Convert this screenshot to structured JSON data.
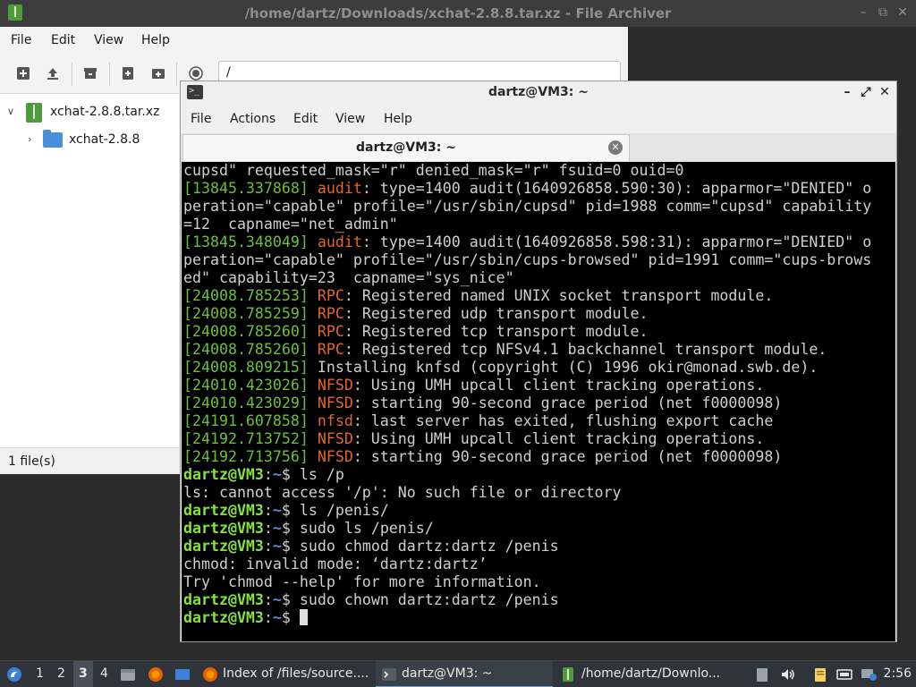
{
  "file_archiver": {
    "title": "/home/dartz/Downloads/xchat-2.8.8.tar.xz - File Archiver",
    "menu": [
      "File",
      "Edit",
      "View",
      "Help"
    ],
    "location": "/",
    "tree": [
      {
        "label": "xchat-2.8.8.tar.xz",
        "icon": "archive-icon",
        "expanded": true
      },
      {
        "label": "xchat-2.8.8",
        "icon": "folder-icon",
        "expanded": false
      }
    ],
    "status": "1 file(s)",
    "window_controls": [
      "–",
      "⧉",
      "✕"
    ]
  },
  "terminal": {
    "title": "dartz@VM3: ~",
    "menu": [
      "File",
      "Actions",
      "Edit",
      "View",
      "Help"
    ],
    "tab_label": "dartz@VM3: ~",
    "window_controls": [
      "–",
      "⤢",
      "✕"
    ],
    "lines": [
      [
        {
          "t": "cupsd\" requested_mask=\"r\" denied_mask=\"r\" fsuid=0 ouid=0",
          "c": ""
        }
      ],
      [
        {
          "t": "[13845.337868] ",
          "c": "c-green"
        },
        {
          "t": "audit",
          "c": "c-orange"
        },
        {
          "t": ": type=1400 audit(1640926858.590:30): apparmor=\"DENIED\" o",
          "c": ""
        }
      ],
      [
        {
          "t": "peration=\"capable\" profile=\"/usr/sbin/cupsd\" pid=1988 comm=\"cupsd\" capability",
          "c": ""
        }
      ],
      [
        {
          "t": "=12  capname=\"net_admin\"",
          "c": ""
        }
      ],
      [
        {
          "t": "[13845.348049] ",
          "c": "c-green"
        },
        {
          "t": "audit",
          "c": "c-orange"
        },
        {
          "t": ": type=1400 audit(1640926858.598:31): apparmor=\"DENIED\" o",
          "c": ""
        }
      ],
      [
        {
          "t": "peration=\"capable\" profile=\"/usr/sbin/cups-browsed\" pid=1991 comm=\"cups-brows",
          "c": ""
        }
      ],
      [
        {
          "t": "ed\" capability=23  capname=\"sys_nice\"",
          "c": ""
        }
      ],
      [
        {
          "t": "[24008.785253] ",
          "c": "c-green"
        },
        {
          "t": "RPC",
          "c": "c-orange"
        },
        {
          "t": ": Registered named UNIX socket transport module.",
          "c": ""
        }
      ],
      [
        {
          "t": "[24008.785259] ",
          "c": "c-green"
        },
        {
          "t": "RPC",
          "c": "c-orange"
        },
        {
          "t": ": Registered udp transport module.",
          "c": ""
        }
      ],
      [
        {
          "t": "[24008.785260] ",
          "c": "c-green"
        },
        {
          "t": "RPC",
          "c": "c-orange"
        },
        {
          "t": ": Registered tcp transport module.",
          "c": ""
        }
      ],
      [
        {
          "t": "[24008.785260] ",
          "c": "c-green"
        },
        {
          "t": "RPC",
          "c": "c-orange"
        },
        {
          "t": ": Registered tcp NFSv4.1 backchannel transport module.",
          "c": ""
        }
      ],
      [
        {
          "t": "[24008.809215] ",
          "c": "c-green"
        },
        {
          "t": "Installing knfsd (copyright (C) 1996 okir@monad.swb.de).",
          "c": ""
        }
      ],
      [
        {
          "t": "[24010.423026] ",
          "c": "c-green"
        },
        {
          "t": "NFSD",
          "c": "c-orange"
        },
        {
          "t": ": Using UMH upcall client tracking operations.",
          "c": ""
        }
      ],
      [
        {
          "t": "[24010.423029] ",
          "c": "c-green"
        },
        {
          "t": "NFSD",
          "c": "c-orange"
        },
        {
          "t": ": starting 90-second grace period (net f0000098)",
          "c": ""
        }
      ],
      [
        {
          "t": "[24191.607858] ",
          "c": "c-green"
        },
        {
          "t": "nfsd",
          "c": "c-orange"
        },
        {
          "t": ": last server has exited, flushing export cache",
          "c": ""
        }
      ],
      [
        {
          "t": "[24192.713752] ",
          "c": "c-green"
        },
        {
          "t": "NFSD",
          "c": "c-orange"
        },
        {
          "t": ": Using UMH upcall client tracking operations.",
          "c": ""
        }
      ],
      [
        {
          "t": "[24192.713756] ",
          "c": "c-green"
        },
        {
          "t": "NFSD",
          "c": "c-orange"
        },
        {
          "t": ": starting 90-second grace period (net f0000098)",
          "c": ""
        }
      ],
      [
        {
          "t": "dartz@VM3",
          "c": "c-prompt"
        },
        {
          "t": ":",
          "c": ""
        },
        {
          "t": "~",
          "c": "c-path"
        },
        {
          "t": "$ ls /p",
          "c": ""
        }
      ],
      [
        {
          "t": "ls: cannot access '/p': No such file or directory",
          "c": ""
        }
      ],
      [
        {
          "t": "dartz@VM3",
          "c": "c-prompt"
        },
        {
          "t": ":",
          "c": ""
        },
        {
          "t": "~",
          "c": "c-path"
        },
        {
          "t": "$ ls /penis/",
          "c": ""
        }
      ],
      [
        {
          "t": "dartz@VM3",
          "c": "c-prompt"
        },
        {
          "t": ":",
          "c": ""
        },
        {
          "t": "~",
          "c": "c-path"
        },
        {
          "t": "$ sudo ls /penis/",
          "c": ""
        }
      ],
      [
        {
          "t": "dartz@VM3",
          "c": "c-prompt"
        },
        {
          "t": ":",
          "c": ""
        },
        {
          "t": "~",
          "c": "c-path"
        },
        {
          "t": "$ sudo chmod dartz:dartz /penis",
          "c": ""
        }
      ],
      [
        {
          "t": "chmod: invalid mode: ‘dartz:dartz’",
          "c": ""
        }
      ],
      [
        {
          "t": "Try 'chmod --help' for more information.",
          "c": ""
        }
      ],
      [
        {
          "t": "dartz@VM3",
          "c": "c-prompt"
        },
        {
          "t": ":",
          "c": ""
        },
        {
          "t": "~",
          "c": "c-path"
        },
        {
          "t": "$ sudo chown dartz:dartz /penis",
          "c": ""
        }
      ],
      [
        {
          "t": "dartz@VM3",
          "c": "c-prompt"
        },
        {
          "t": ":",
          "c": ""
        },
        {
          "t": "~",
          "c": "c-path"
        },
        {
          "t": "$ ",
          "c": ""
        }
      ]
    ]
  },
  "taskbar": {
    "workspaces": [
      "1",
      "2",
      "3",
      "4"
    ],
    "active_workspace": "3",
    "tasks": [
      {
        "label": "Index of /files/source....",
        "icon": "firefox-icon"
      },
      {
        "label": "dartz@VM3: ~",
        "icon": "terminal-icon",
        "active": true
      },
      {
        "label": "/home/dartz/Downlo...",
        "icon": "archive-icon"
      }
    ],
    "clock": "2:56"
  },
  "colors": {
    "terminal_bg": "#000000",
    "timestamp": "#6bbf3b",
    "subsystem": "#e0662a",
    "prompt": "#86e23b",
    "taskbar_bg": "#2f343b"
  }
}
